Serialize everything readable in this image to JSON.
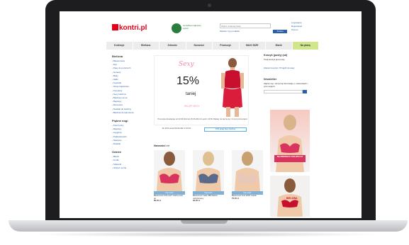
{
  "header": {
    "logo": "kontri.pl",
    "badge_text": "Certyfikat najlepszy wybór",
    "search_placeholder": "Wpisz szukaną frazę",
    "search_scope": "Wybierz typ produktu",
    "search_button": "Szukaj",
    "account_links": [
      "Logowanie",
      "Rejestracja",
      "Pomoc"
    ]
  },
  "nav": [
    "Kolekcje",
    "Bielizna",
    "Zdrowie",
    "Nowości",
    "Promocje",
    "MAXI SIZE",
    "Marki",
    "Na plażę"
  ],
  "sidebar": {
    "sections": [
      {
        "title": "Bielizna",
        "items": [
          "Biustonosze",
          "Figi",
          "Pasy do pończoch",
          "Gorsety",
          "Body",
          "Halki",
          "Koszulki",
          "Stroje kąpielowe",
          "Komplety",
          "Sexy bielizna",
          "Bielizna nocna",
          "Rajstopy",
          "Akcesoria",
          "Dodatki do bielizny",
          "Bielizna do karmienia"
        ]
      },
      {
        "title": "Piękne nogi",
        "items": [
          "Pończochy",
          "Rajstopy",
          "Legginsy",
          "Podkolanówki",
          "Skarpety",
          "Dodatki"
        ]
      },
      {
        "title": "Odzież",
        "items": [
          "Bluzki",
          "Tuniki",
          "Sukienki",
          "Odzież nocna"
        ]
      }
    ]
  },
  "banner": {
    "script": "Sexy",
    "discount": "15%",
    "discount_label": "taniej",
    "cta": "SKLEP SEXY",
    "note": "Promocja obowiązuje od 10.06.2014 do 15.06.2014 do godz. 23:59. Rabaty nie łączą się z innymi promocjami.",
    "tabs": [
      "Do 40% taniej KRASLINE & VIOVA",
      "15% taniej Sexy bielizna"
    ]
  },
  "right": {
    "cart_title": "Koszyk (pusty) (od)",
    "cart_text": "Twój koszyk jest pusty",
    "cart_link": "Zobacz koszyk / Przejdź do kasy",
    "newsletter_title": "Newsletter",
    "newsletter_text": "Zapisz się i otrzymuj informacje o nowościach i promocjach.",
    "newsletter_placeholder": "Twój adres e-mail",
    "ad1_caption": "NAJNOWSZA KOLEKCJA",
    "ad2_caption": "BIELIZNA"
  },
  "new_products": {
    "title": "Nowości >>",
    "items": [
      {
        "button": "Kup teraz",
        "name": "Biustonosz AVA 1127 Carla push-up",
        "price": "89,00 zł"
      },
      {
        "button": "Kup teraz",
        "name": "Biustonosz Gaia 388 Mariss usztywniany",
        "price": "92,00 zł"
      },
      {
        "button": "Kup teraz",
        "name": "Biustonosz Ava 1064 miękki",
        "price": "79,00 zł"
      }
    ]
  },
  "colors": {
    "accent": "#2b5ea8",
    "brand": "#e2001a",
    "promo": "#cfe78a"
  }
}
